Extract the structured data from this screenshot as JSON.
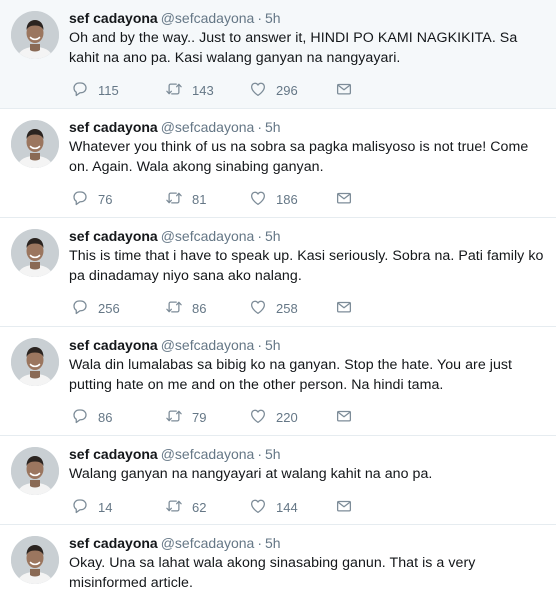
{
  "tweets": [
    {
      "name": "sef cadayona",
      "handle": "@sefcadayona",
      "separator": "·",
      "time": "5h",
      "text": "Oh and by the way.. Just to answer it, HINDI PO KAMI NAGKIKITA. Sa kahit na ano pa. Kasi walang ganyan na nangyayari.",
      "replies": "115",
      "retweets": "143",
      "likes": "296",
      "highlighted": true
    },
    {
      "name": "sef cadayona",
      "handle": "@sefcadayona",
      "separator": "·",
      "time": "5h",
      "text": "Whatever you think of us na sobra sa pagka malisyoso is not true! Come on. Again. Wala akong sinabing ganyan.",
      "replies": "76",
      "retweets": "81",
      "likes": "186"
    },
    {
      "name": "sef cadayona",
      "handle": "@sefcadayona",
      "separator": "·",
      "time": "5h",
      "text": "This is time that i have to speak up. Kasi seriously. Sobra na. Pati family ko pa dinadamay niyo sana ako nalang.",
      "replies": "256",
      "retweets": "86",
      "likes": "258"
    },
    {
      "name": "sef cadayona",
      "handle": "@sefcadayona",
      "separator": "·",
      "time": "5h",
      "text": "Wala din lumalabas sa bibig ko na ganyan. Stop the hate. You are just putting hate on me and on the other person. Na hindi tama.",
      "replies": "86",
      "retweets": "79",
      "likes": "220"
    },
    {
      "name": "sef cadayona",
      "handle": "@sefcadayona",
      "separator": "·",
      "time": "5h",
      "text": "Walang ganyan na nangyayari at walang kahit na ano pa.",
      "replies": "14",
      "retweets": "62",
      "likes": "144"
    },
    {
      "name": "sef cadayona",
      "handle": "@sefcadayona",
      "separator": "·",
      "time": "5h",
      "text": "Okay. Una sa lahat wala akong sinasabing ganun. That is a very misinformed article."
    }
  ],
  "icons": {
    "reply": "reply-icon",
    "retweet": "retweet-icon",
    "like": "heart-icon",
    "message": "envelope-icon"
  },
  "colors": {
    "highlight_bg": "#f5f8fa",
    "divider": "#e6ecf0",
    "secondary_text": "#657786",
    "icon": "#7d8c98"
  }
}
